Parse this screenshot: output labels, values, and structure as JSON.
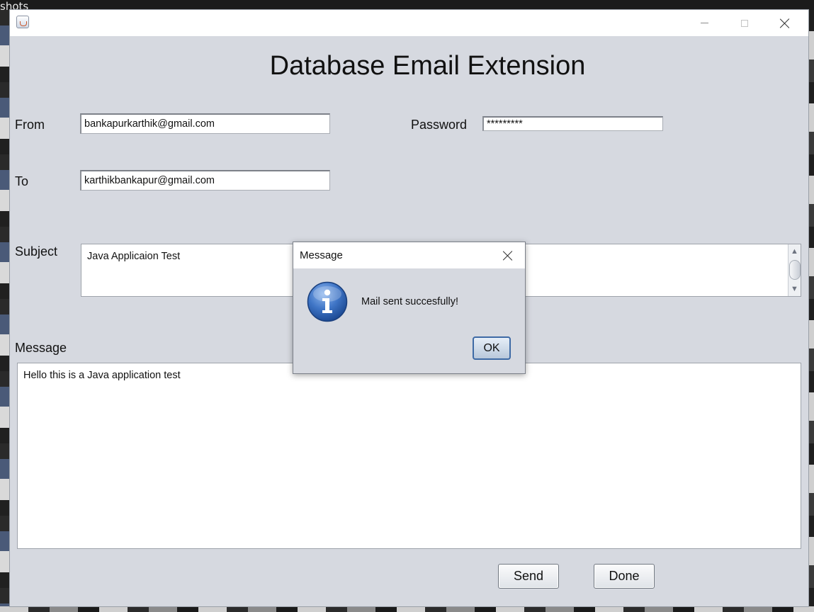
{
  "background": {
    "corner_text": "shots"
  },
  "window": {
    "heading": "Database Email Extension"
  },
  "form": {
    "from_label": "From",
    "from_value": "bankapurkarthik@gmail.com",
    "password_label": "Password",
    "password_value": "*********",
    "to_label": "To",
    "to_value": "karthikbankapur@gmail.com",
    "subject_label": "Subject",
    "subject_value": "Java Applicaion Test",
    "message_label": "Message",
    "message_value": "Hello this is a Java application test",
    "send_label": "Send",
    "done_label": "Done"
  },
  "dialog": {
    "title": "Message",
    "message": "Mail sent succesfully!",
    "ok_label": "OK",
    "icon": "info-icon"
  },
  "colors": {
    "window_bg": "#d6d9e0",
    "ok_border": "#3e6aa5",
    "info_blue": "#2f66b8"
  }
}
